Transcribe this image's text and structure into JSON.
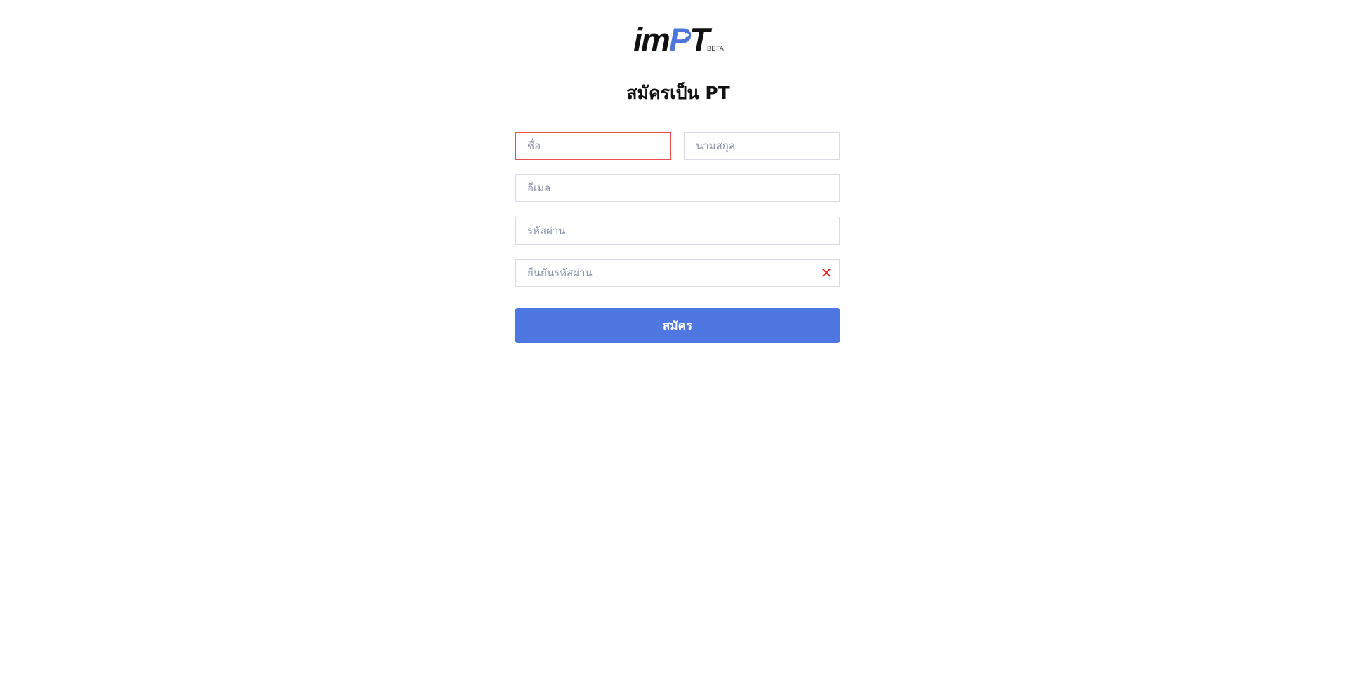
{
  "logo": {
    "text_im": "im",
    "text_p": "P",
    "text_t": "T",
    "beta": "BETA",
    "accent_color": "#4b76dc"
  },
  "title": "สมัครเป็น PT",
  "form": {
    "first_name": {
      "placeholder": "ชื่อ",
      "value": "",
      "state": "error"
    },
    "last_name": {
      "placeholder": "นามสกุล",
      "value": ""
    },
    "email": {
      "placeholder": "อีเมล",
      "value": ""
    },
    "password": {
      "placeholder": "รหัสผ่าน",
      "value": ""
    },
    "confirm_password": {
      "placeholder": "ยืนยันรหัสผ่าน",
      "value": "",
      "clear_icon": "close-icon"
    },
    "submit_label": "สมัคร",
    "submit_color": "#4e77e2",
    "error_color": "#ee4b4b"
  }
}
